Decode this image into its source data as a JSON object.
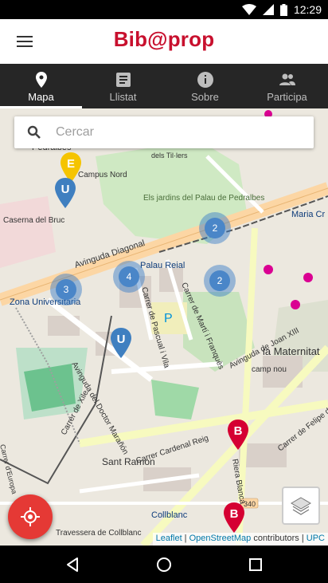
{
  "status_bar": {
    "time": "12:29",
    "icons": [
      "wifi-icon",
      "signal-icon",
      "battery-icon"
    ]
  },
  "app": {
    "logo": "Bib@prop",
    "brand_color": "#c8102e"
  },
  "tabs": [
    {
      "label": "Mapa",
      "icon": "map-pin-icon",
      "active": true
    },
    {
      "label": "Llistat",
      "icon": "list-icon",
      "active": false
    },
    {
      "label": "Sobre",
      "icon": "info-icon",
      "active": false
    },
    {
      "label": "Participa",
      "icon": "people-icon",
      "active": false
    }
  ],
  "search": {
    "placeholder": "Cercar",
    "value": ""
  },
  "map": {
    "street_labels": [
      "Avinguda Diagonal",
      "Palau Reial",
      "Zona Universitària",
      "Maria Cr",
      "Els jardins del Palau de Pedralbes",
      "Caserna del Bruc",
      "Campus Nord",
      "Avinguda del Doctor Marañón",
      "Avinguda de Joan XIII",
      "Carrer de Martí i Franquès",
      "Carrer de Pascual i Vila",
      "Carrer Cardenal Reig",
      "Carrer de Xile",
      "Sant Ramon",
      "Riera Blanca",
      "Collblanc",
      "la Maternitat",
      "camp nou",
      "Carrer de Felipe de",
      "Travessera de Collblanc",
      "Pedralbes",
      "dels Til·lers",
      "Carrer d'Europa"
    ],
    "clusters": [
      "2",
      "4",
      "3",
      "2"
    ],
    "pins": [
      {
        "letter": "E",
        "color": "#f5c400"
      },
      {
        "letter": "U",
        "color": "#3f7fc0"
      },
      {
        "letter": "U",
        "color": "#3f7fc0"
      },
      {
        "letter": "B",
        "color": "#d50032"
      },
      {
        "letter": "B",
        "color": "#d50032"
      }
    ],
    "parking_label": "P",
    "road_number": "340"
  },
  "attribution": {
    "leaflet": "Leaflet",
    "separator": " | ",
    "osm": "OpenStreetMap",
    "contributors": " contributors | ",
    "upc": "UPC"
  },
  "nav_bar": {
    "icons": [
      "back-icon",
      "home-icon",
      "recents-icon"
    ]
  }
}
